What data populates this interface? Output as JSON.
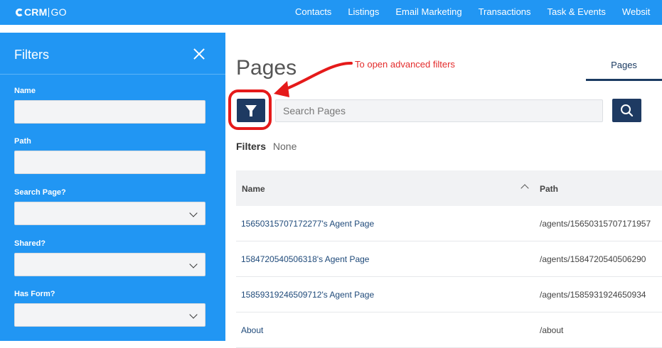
{
  "app": {
    "logo_main": "CRM",
    "logo_go": "GO"
  },
  "nav": [
    "Contacts",
    "Listings",
    "Email Marketing",
    "Transactions",
    "Task & Events",
    "Websit"
  ],
  "filters_panel": {
    "title": "Filters",
    "fields": [
      {
        "label": "Name",
        "type": "text",
        "value": ""
      },
      {
        "label": "Path",
        "type": "text",
        "value": ""
      },
      {
        "label": "Search Page?",
        "type": "select",
        "value": ""
      },
      {
        "label": "Shared?",
        "type": "select",
        "value": ""
      },
      {
        "label": "Has Form?",
        "type": "select",
        "value": ""
      }
    ]
  },
  "main": {
    "title": "Pages",
    "annotation": "To open advanced filters",
    "tab": "Pages",
    "search": {
      "placeholder": "Search Pages",
      "value": ""
    },
    "filters_label": "Filters",
    "filters_value": "None",
    "table": {
      "columns": [
        "Name",
        "Path"
      ],
      "rows": [
        {
          "name": "15650315707172277's Agent Page",
          "path": "/agents/15650315707171957"
        },
        {
          "name": "1584720540506318's Agent Page",
          "path": "/agents/1584720540506290"
        },
        {
          "name": "15859319246509712's Agent Page",
          "path": "/agents/1585931924650934"
        },
        {
          "name": "About",
          "path": "/about"
        }
      ]
    }
  },
  "icons": {
    "logo": "crm-go-logo-icon",
    "close": "close-icon",
    "filter": "funnel-icon",
    "search": "search-icon",
    "sort": "chevron-up-icon",
    "select": "chevron-down-icon"
  },
  "colors": {
    "brand_blue": "#2196f3",
    "navy": "#1e3a62",
    "annotation_red": "#e51a1a",
    "link": "#1f4a7a"
  }
}
